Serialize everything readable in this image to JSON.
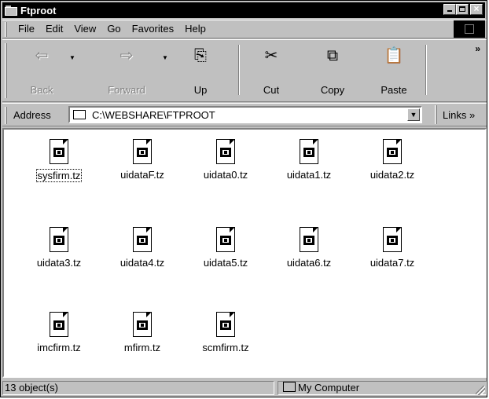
{
  "window": {
    "title": "Ftproot"
  },
  "menu": {
    "items": [
      "File",
      "Edit",
      "View",
      "Go",
      "Favorites",
      "Help"
    ]
  },
  "toolbar": {
    "buttons": [
      {
        "label": "Back",
        "icon": "back-arrow-icon",
        "enabled": false
      },
      {
        "label": "Forward",
        "icon": "forward-arrow-icon",
        "enabled": false
      },
      {
        "label": "Up",
        "icon": "up-folder-icon",
        "enabled": true
      },
      {
        "label": "Cut",
        "icon": "scissors-icon",
        "enabled": true
      },
      {
        "label": "Copy",
        "icon": "copy-icon",
        "enabled": true
      },
      {
        "label": "Paste",
        "icon": "paste-icon",
        "enabled": true
      }
    ],
    "more": "»"
  },
  "address": {
    "label": "Address",
    "value": "C:\\WEBSHARE\\FTPROOT",
    "links_label": "Links »"
  },
  "files": [
    {
      "name": "sysfirm.tz",
      "selected": true
    },
    {
      "name": "uidataF.tz"
    },
    {
      "name": "uidata0.tz"
    },
    {
      "name": "uidata1.tz"
    },
    {
      "name": "uidata2.tz"
    },
    {
      "name": "uidata3.tz"
    },
    {
      "name": "uidata4.tz"
    },
    {
      "name": "uidata5.tz"
    },
    {
      "name": "uidata6.tz"
    },
    {
      "name": "uidata7.tz"
    },
    {
      "name": "imcfirm.tz"
    },
    {
      "name": "mfirm.tz"
    },
    {
      "name": "scmfirm.tz"
    }
  ],
  "status": {
    "count": "13 object(s)",
    "zone": "My Computer"
  }
}
